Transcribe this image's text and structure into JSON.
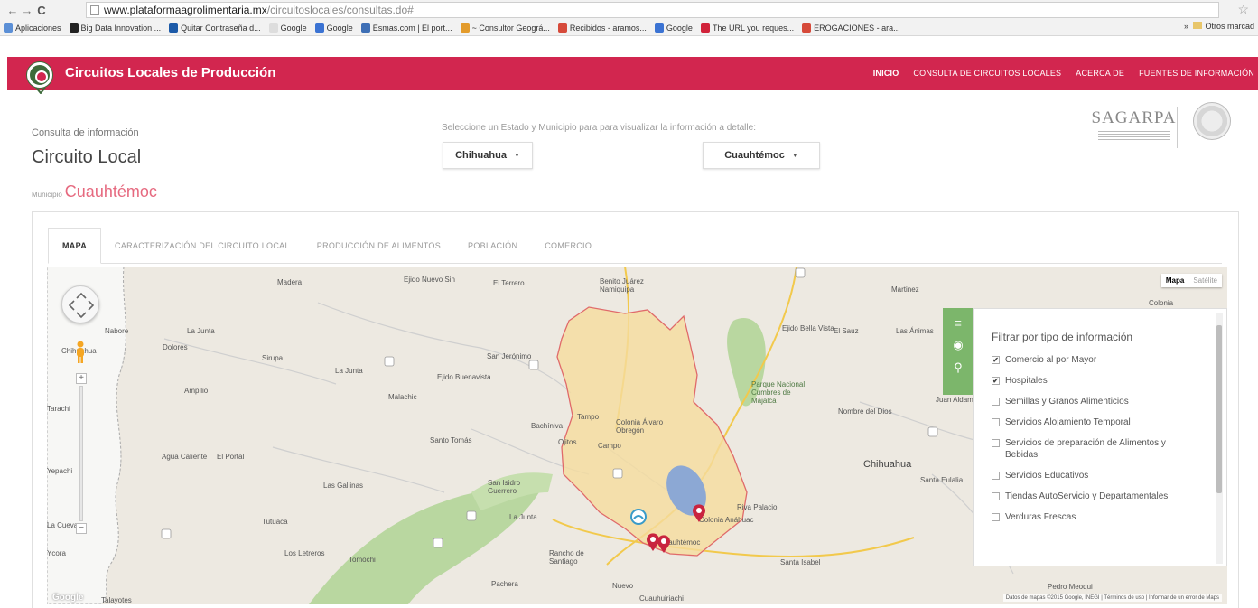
{
  "browser": {
    "back": "←",
    "forward": "→",
    "reload": "C",
    "url_host": "www.plataformaagrolimentaria.mx",
    "url_path": "/circuitoslocales/consultas.do#",
    "bookmarks": [
      {
        "label": "Aplicaciones",
        "color": "#5b8fd6"
      },
      {
        "label": "Big Data Innovation ...",
        "color": "#222222"
      },
      {
        "label": "Quitar Contraseña d...",
        "color": "#1c5aa8"
      },
      {
        "label": "Google",
        "color": "#dddddd"
      },
      {
        "label": "Google",
        "color": "#3b73d3"
      },
      {
        "label": "Esmas.com | El port...",
        "color": "#3e6fb5"
      },
      {
        "label": "~ Consultor Geográ...",
        "color": "#e39b2b"
      },
      {
        "label": "Recibidos - aramos...",
        "color": "#d64a3a"
      },
      {
        "label": "Google",
        "color": "#3b73d3"
      },
      {
        "label": "The URL you reques...",
        "color": "#d1233a"
      },
      {
        "label": "EROGACIONES - ara...",
        "color": "#d64a3a"
      }
    ],
    "bookmarks_more": "»",
    "other_bookmarks": "Otros marcad"
  },
  "header": {
    "title": "Circuitos Locales de Producción",
    "nav": [
      "INICIO",
      "CONSULTA DE CIRCUITOS LOCALES",
      "ACERCA DE",
      "FUENTES DE INFORMACIÓN"
    ]
  },
  "info": {
    "label": "Consulta de información",
    "title": "Circuito Local",
    "municipio_label": "Municipio",
    "municipio_value": "Cuauhtémoc",
    "select_prompt": "Seleccione un Estado y Municipio para para visualizar la información a detalle:",
    "state_value": "Chihuahua",
    "municipio_select_value": "Cuauhtémoc",
    "caret": "▼"
  },
  "logos": {
    "sagarpa": "SAGARPA"
  },
  "tabs": [
    "MAPA",
    "CARACTERIZACIÓN DEL CIRCUITO LOCAL",
    "PRODUCCIÓN DE ALIMENTOS",
    "POBLACIÓN",
    "COMERCIO"
  ],
  "map": {
    "map_type": [
      "Mapa",
      "Satélite"
    ],
    "zoom_in": "+",
    "zoom_out": "−",
    "google": "Google",
    "attribution": "Datos de mapas ©2015 Google, INEGI | Términos de uso | Informar de un error de Maps",
    "places": [
      {
        "text": "Madera",
        "cls": ""
      },
      {
        "text": "Ejido Nuevo Sin",
        "cls": ""
      },
      {
        "text": "El Terrero",
        "cls": ""
      },
      {
        "text": "Benito Juárez Namiquipa",
        "cls": ""
      },
      {
        "text": "Martinez",
        "cls": ""
      },
      {
        "text": "Colonia",
        "cls": ""
      },
      {
        "text": "Nabore",
        "cls": ""
      },
      {
        "text": "La Junta",
        "cls": ""
      },
      {
        "text": "Chihuahua",
        "cls": ""
      },
      {
        "text": "Dolores",
        "cls": ""
      },
      {
        "text": "Sirupa",
        "cls": ""
      },
      {
        "text": "La Junta",
        "cls": ""
      },
      {
        "text": "San Jerónimo",
        "cls": ""
      },
      {
        "text": "Ejido Bella Vista",
        "cls": ""
      },
      {
        "text": "El Sauz",
        "cls": ""
      },
      {
        "text": "Las Ánimas",
        "cls": ""
      },
      {
        "text": "Ampilio",
        "cls": ""
      },
      {
        "text": "Ejido Buenavista",
        "cls": ""
      },
      {
        "text": "Malachic",
        "cls": ""
      },
      {
        "text": "Parque Nacional Cumbres de Majalca",
        "cls": "green"
      },
      {
        "text": "Juan Aldama",
        "cls": ""
      },
      {
        "text": "Tarachi",
        "cls": ""
      },
      {
        "text": "Tampo",
        "cls": ""
      },
      {
        "text": "Colonia Álvaro Obregón",
        "cls": ""
      },
      {
        "text": "Bachíniva",
        "cls": ""
      },
      {
        "text": "Nombre del Dios",
        "cls": ""
      },
      {
        "text": "Santo Tomás",
        "cls": ""
      },
      {
        "text": "Ojitos",
        "cls": ""
      },
      {
        "text": "Campo",
        "cls": ""
      },
      {
        "text": "Agua Caliente",
        "cls": ""
      },
      {
        "text": "El Portal",
        "cls": ""
      },
      {
        "text": "Chihuahua",
        "cls": "city"
      },
      {
        "text": "Yepachi",
        "cls": ""
      },
      {
        "text": "Las Gallinas",
        "cls": ""
      },
      {
        "text": "San Isidro Guerrero",
        "cls": ""
      },
      {
        "text": "Riva Palacio",
        "cls": ""
      },
      {
        "text": "Santa Eulalia",
        "cls": ""
      },
      {
        "text": "Tutuaca",
        "cls": ""
      },
      {
        "text": "La Junta",
        "cls": ""
      },
      {
        "text": "Colonia Anáhuac",
        "cls": ""
      },
      {
        "text": "La Cueva",
        "cls": ""
      },
      {
        "text": "Cuauhtémoc",
        "cls": ""
      },
      {
        "text": "Ycora",
        "cls": ""
      },
      {
        "text": "Los Letreros",
        "cls": ""
      },
      {
        "text": "Tomochi",
        "cls": ""
      },
      {
        "text": "Rancho de Santiago",
        "cls": ""
      },
      {
        "text": "Santa Isabel",
        "cls": ""
      },
      {
        "text": "Pachera",
        "cls": ""
      },
      {
        "text": "Nuevo",
        "cls": ""
      },
      {
        "text": "Cuauhuiriachi",
        "cls": ""
      },
      {
        "text": "Pedro Meoqui",
        "cls": ""
      },
      {
        "text": "Talayotes",
        "cls": ""
      }
    ]
  },
  "filters": {
    "title": "Filtrar por tipo de información",
    "check_mark": "✔",
    "items": [
      {
        "label": "Comercio al por Mayor",
        "checked": true
      },
      {
        "label": "Hospitales",
        "checked": true
      },
      {
        "label": "Semillas y Granos Alimenticios",
        "checked": false
      },
      {
        "label": "Servicios Alojamiento Temporal",
        "checked": false
      },
      {
        "label": "Servicios de preparación de Alimentos y Bebidas",
        "checked": false
      },
      {
        "label": "Servicios Educativos",
        "checked": false
      },
      {
        "label": "Tiendas AutoServicio y Departamentales",
        "checked": false
      },
      {
        "label": "Verduras Frescas",
        "checked": false
      }
    ]
  }
}
